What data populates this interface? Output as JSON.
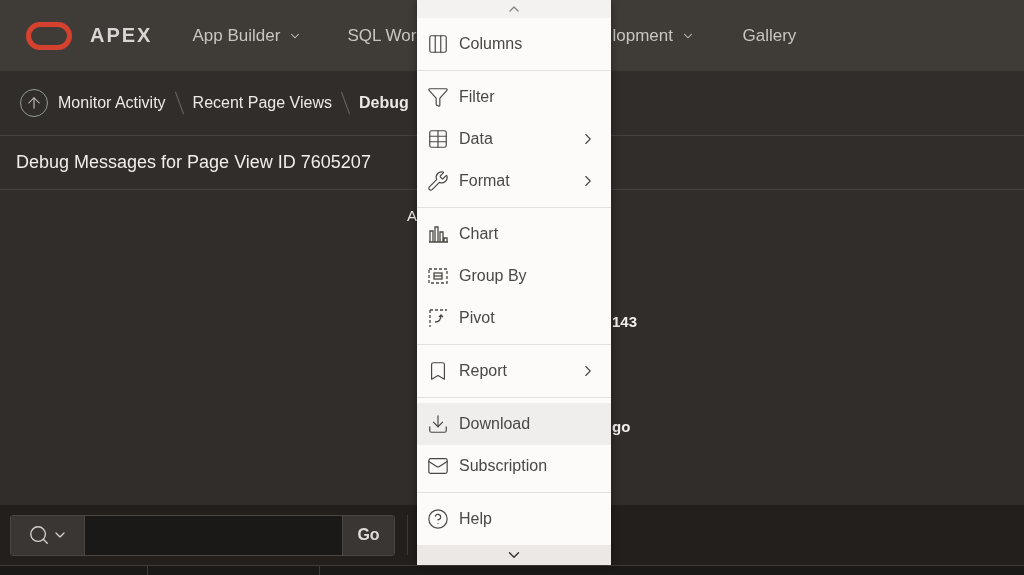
{
  "header": {
    "logo_text": "APEX",
    "nav": [
      {
        "label": "App Builder",
        "dropdown": true
      },
      {
        "label": "SQL Wor"
      },
      {
        "label": "lopment",
        "dropdown": true
      },
      {
        "label": "Gallery",
        "dropdown": false
      }
    ]
  },
  "breadcrumb": {
    "items": [
      {
        "label": "Monitor Activity",
        "current": false
      },
      {
        "label": "Recent Page Views",
        "current": false
      },
      {
        "label": "Debug",
        "current": true
      }
    ]
  },
  "region_title": "Debug Messages for Page View ID 7605207",
  "behind_fragments": [
    {
      "text": "A",
      "bold": false
    },
    {
      "text": "143",
      "bold": true
    },
    {
      "text": "go",
      "bold": true
    }
  ],
  "toolbar": {
    "go_label": "Go"
  },
  "menu": {
    "groups": [
      [
        {
          "kind": "columns",
          "label": "Columns",
          "submenu": false,
          "selected": false
        }
      ],
      [
        {
          "kind": "filter",
          "label": "Filter",
          "submenu": false,
          "selected": false
        },
        {
          "kind": "data",
          "label": "Data",
          "submenu": true,
          "selected": false
        },
        {
          "kind": "format",
          "label": "Format",
          "submenu": true,
          "selected": false
        }
      ],
      [
        {
          "kind": "chart",
          "label": "Chart",
          "submenu": false,
          "selected": false
        },
        {
          "kind": "groupby",
          "label": "Group By",
          "submenu": false,
          "selected": false
        },
        {
          "kind": "pivot",
          "label": "Pivot",
          "submenu": false,
          "selected": false
        }
      ],
      [
        {
          "kind": "report",
          "label": "Report",
          "submenu": true,
          "selected": false
        }
      ],
      [
        {
          "kind": "download",
          "label": "Download",
          "submenu": false,
          "selected": true
        },
        {
          "kind": "subscription",
          "label": "Subscription",
          "submenu": false,
          "selected": false
        }
      ],
      [
        {
          "kind": "help",
          "label": "Help",
          "submenu": false,
          "selected": false
        }
      ]
    ]
  }
}
